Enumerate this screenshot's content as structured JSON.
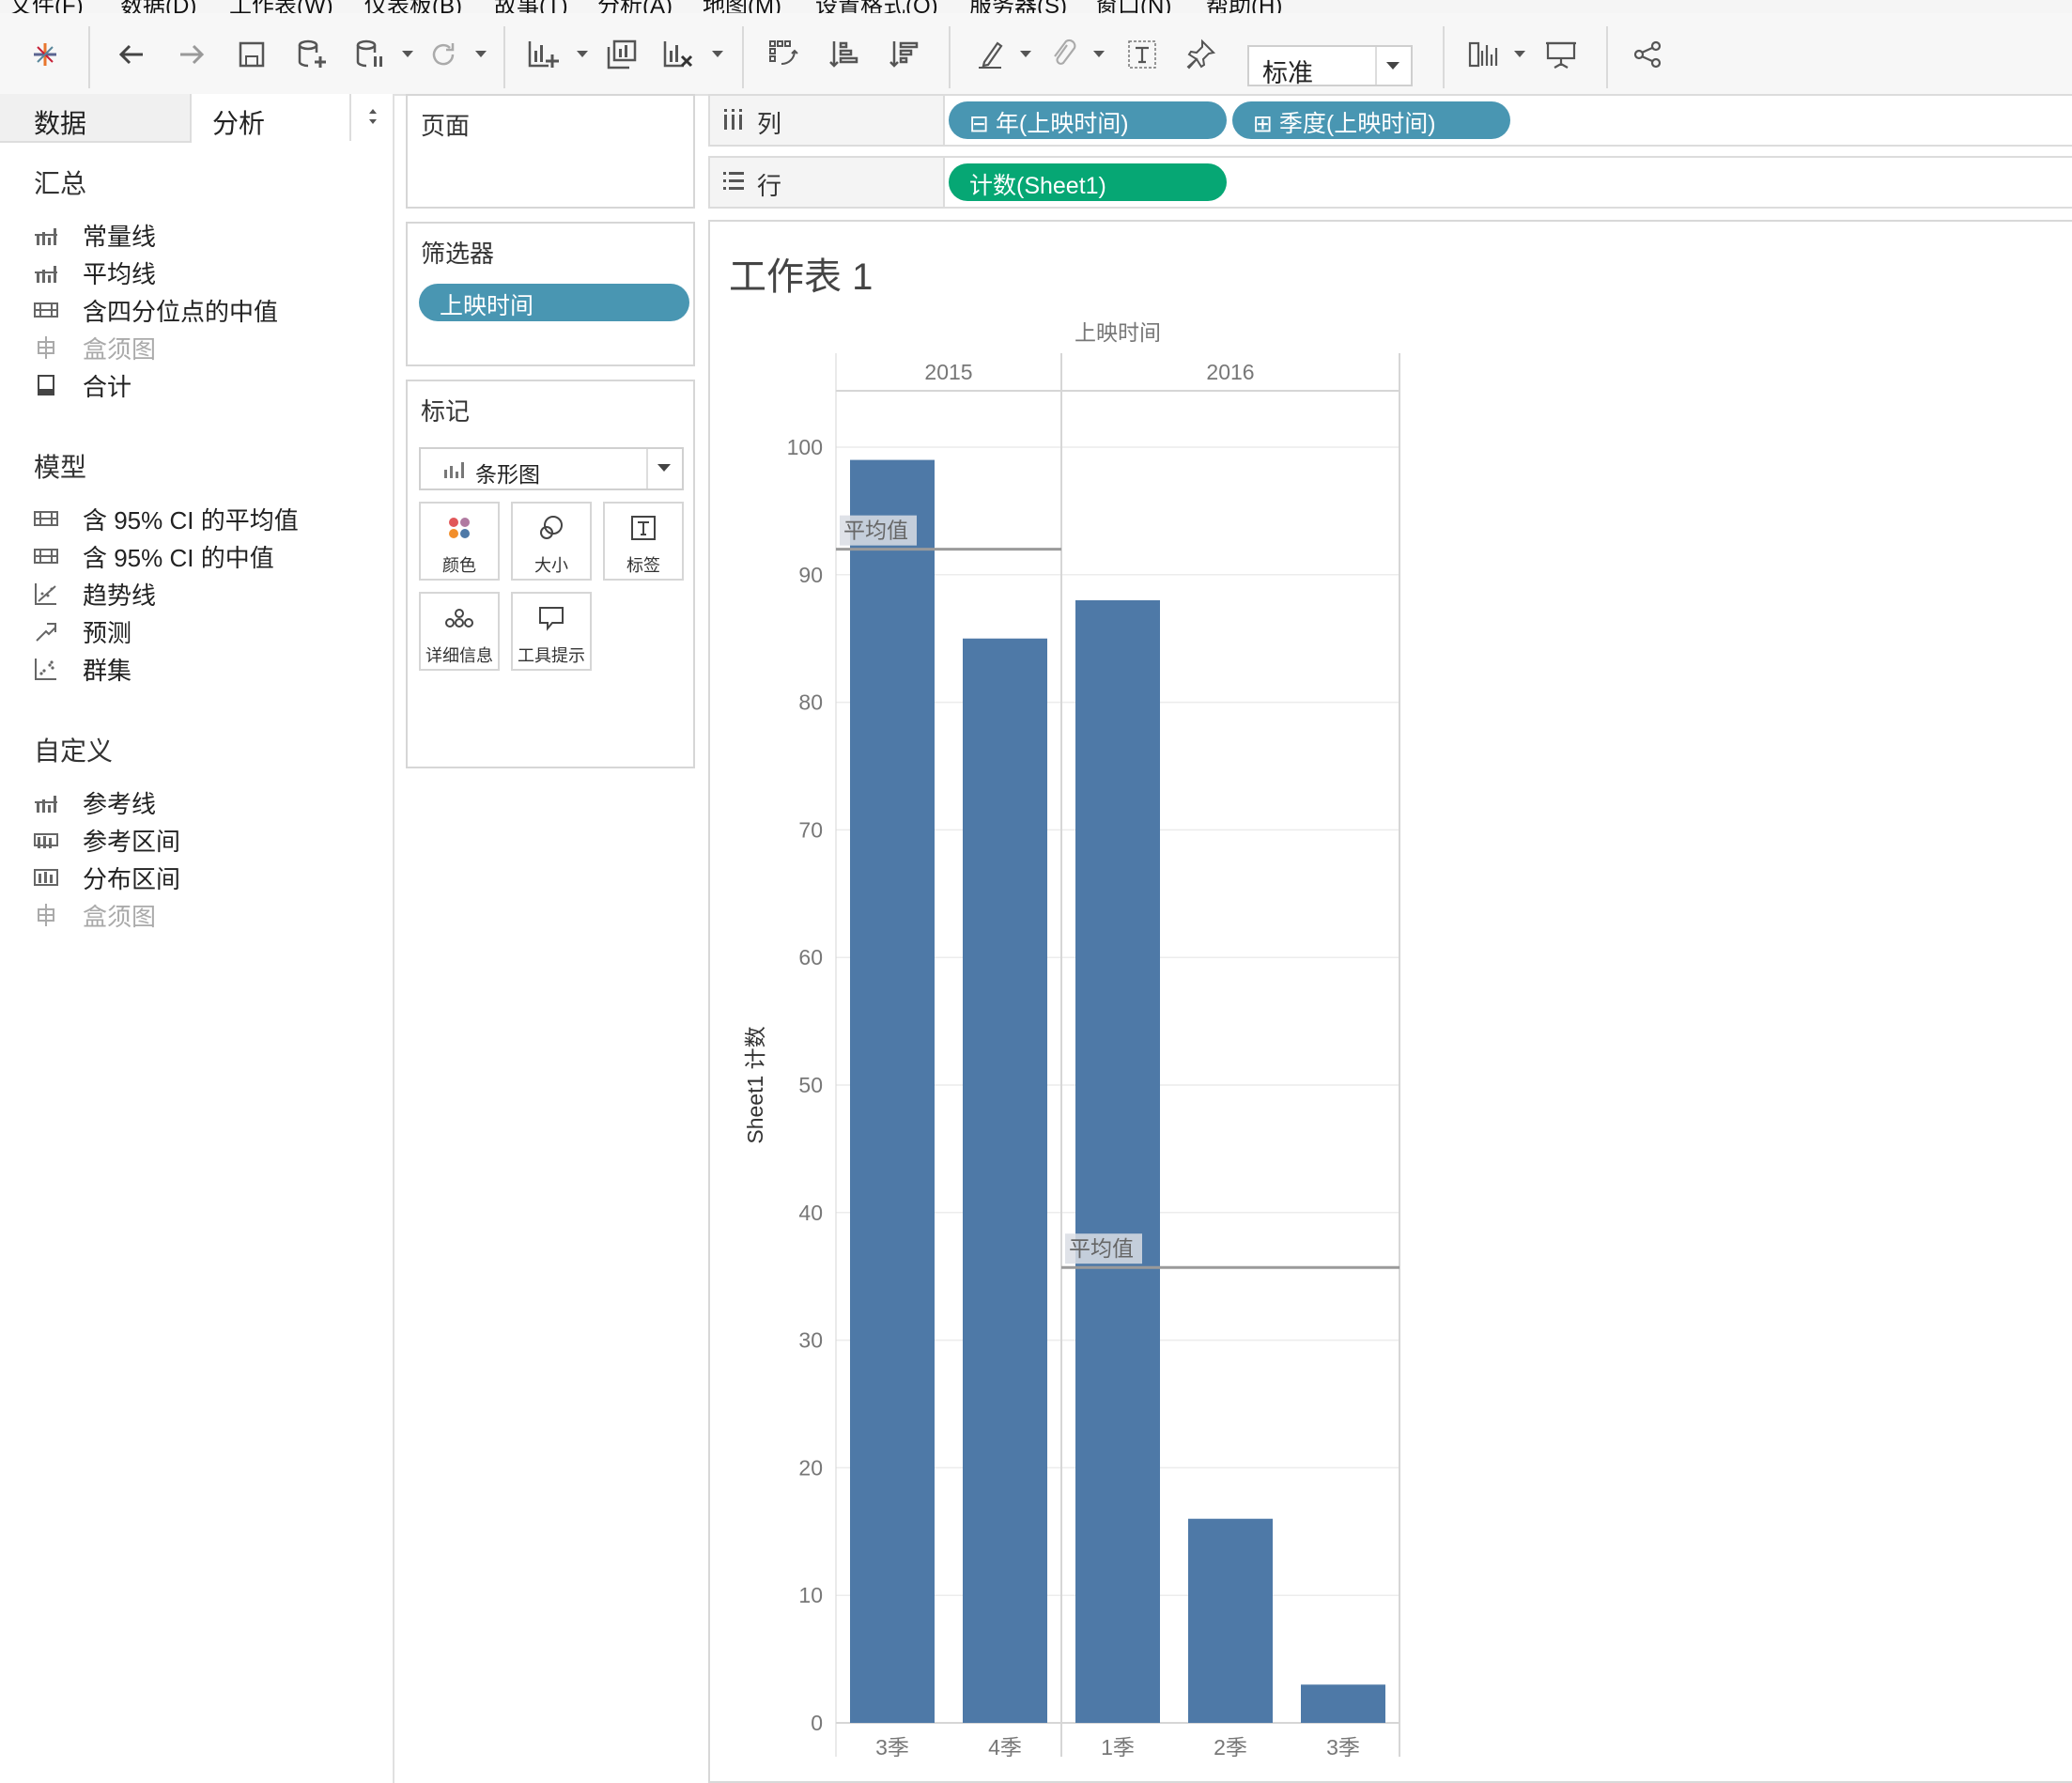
{
  "menu": [
    "文件(F)",
    "数据(D)",
    "工作表(W)",
    "仪表板(B)",
    "故事(T)",
    "分析(A)",
    "地图(M)",
    "设置格式(O)",
    "服务器(S)",
    "窗口(N)",
    "帮助(H)"
  ],
  "toolbar": {
    "fit_select": "标准",
    "icons": [
      "tableau-logo-icon",
      "undo-icon",
      "redo-icon",
      "save-icon",
      "new-datasource-icon",
      "pause-autoupdate-icon",
      "refresh-icon",
      "new-worksheet-icon",
      "duplicate-sheet-icon",
      "clear-sheet-icon",
      "swap-axes-icon",
      "sort-ascending-icon",
      "sort-descending-icon",
      "highlight-icon",
      "group-icon",
      "label-icon",
      "pin-icon",
      "show-me-icon",
      "presentation-icon",
      "share-icon"
    ]
  },
  "left_panel": {
    "tabs": [
      "数据",
      "分析"
    ],
    "sections": [
      {
        "title": "汇总",
        "items": [
          {
            "label": "常量线",
            "icon": "constant-line-icon",
            "enabled": true
          },
          {
            "label": "平均线",
            "icon": "average-line-icon",
            "enabled": true
          },
          {
            "label": "含四分位点的中值",
            "icon": "median-quartiles-icon",
            "enabled": true
          },
          {
            "label": "盒须图",
            "icon": "box-plot-icon",
            "enabled": false
          },
          {
            "label": "合计",
            "icon": "totals-icon",
            "enabled": true
          }
        ]
      },
      {
        "title": "模型",
        "items": [
          {
            "label": "含 95% CI 的平均值",
            "icon": "average-ci-icon",
            "enabled": true
          },
          {
            "label": "含 95% CI 的中值",
            "icon": "median-ci-icon",
            "enabled": true
          },
          {
            "label": "趋势线",
            "icon": "trend-line-icon",
            "enabled": true
          },
          {
            "label": "预测",
            "icon": "forecast-icon",
            "enabled": true
          },
          {
            "label": "群集",
            "icon": "cluster-icon",
            "enabled": true
          }
        ]
      },
      {
        "title": "自定义",
        "items": [
          {
            "label": "参考线",
            "icon": "reference-line-icon",
            "enabled": true
          },
          {
            "label": "参考区间",
            "icon": "reference-band-icon",
            "enabled": true
          },
          {
            "label": "分布区间",
            "icon": "distribution-band-icon",
            "enabled": true
          },
          {
            "label": "盒须图",
            "icon": "box-plot-icon",
            "enabled": false
          }
        ]
      }
    ]
  },
  "pages_card": {
    "title": "页面"
  },
  "filters_card": {
    "title": "筛选器",
    "pill": "上映时间"
  },
  "marks_card": {
    "title": "标记",
    "mark_type": "条形图",
    "buttons": [
      {
        "label": "颜色",
        "icon": "color-icon"
      },
      {
        "label": "大小",
        "icon": "size-icon"
      },
      {
        "label": "标签",
        "icon": "label-icon"
      },
      {
        "label": "详细信息",
        "icon": "detail-icon"
      },
      {
        "label": "工具提示",
        "icon": "tooltip-icon"
      }
    ]
  },
  "shelves": {
    "columns": {
      "label": "列",
      "pills": [
        "⊟ 年(上映时间)",
        "⊞ 季度(上映时间)"
      ]
    },
    "rows": {
      "label": "行",
      "pills": [
        "计数(Sheet1)"
      ]
    }
  },
  "colors": {
    "pill_blue": "#4996b2",
    "pill_green": "#06a774",
    "bar": "#4e79a7"
  },
  "sheet": {
    "title": "工作表 1"
  },
  "chart_data": {
    "type": "bar",
    "column_header": "上映时间",
    "groups": [
      {
        "name": "2015",
        "categories": [
          "3季",
          "4季"
        ],
        "values": [
          99,
          85
        ],
        "reference_line": {
          "label": "平均值",
          "value": 92
        }
      },
      {
        "name": "2016",
        "categories": [
          "1季",
          "2季",
          "3季"
        ],
        "values": [
          88,
          16,
          3
        ],
        "reference_line": {
          "label": "平均值",
          "value": 35.7
        }
      }
    ],
    "ylabel": "Sheet1 计数",
    "yticks": [
      0,
      10,
      20,
      30,
      40,
      50,
      60,
      70,
      80,
      90,
      100
    ],
    "ylim": [
      0,
      102
    ],
    "grid": true
  }
}
